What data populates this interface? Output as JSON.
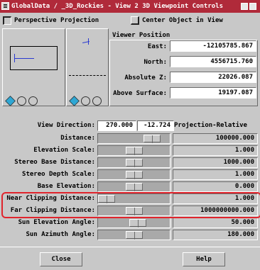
{
  "window": {
    "title": "GlobalData / _3D_Rockies - View 2 3D Viewpoint Controls"
  },
  "options": {
    "perspective_projection": "Perspective Projection",
    "perspective_checked": true,
    "center_object": "Center Object in View",
    "center_checked": false
  },
  "viewer_position": {
    "heading": "Viewer Position",
    "fields": [
      {
        "label": "East:",
        "value": "-12105785.867"
      },
      {
        "label": "North:",
        "value": "4556715.760"
      },
      {
        "label": "Absolute Z:",
        "value": "22026.087"
      },
      {
        "label": "Above Surface:",
        "value": "19197.087"
      }
    ]
  },
  "view_direction": {
    "label": "View Direction:",
    "azimuth": "270.000",
    "elevation": "-12.724",
    "mode": "Projection-Relative"
  },
  "sliders": [
    {
      "label": "Distance:",
      "value": "100000.000",
      "level": 0.83
    },
    {
      "label": "Elevation Scale:",
      "value": "1.000",
      "level": 0.5
    },
    {
      "label": "Stereo Base Distance:",
      "value": "1000.000",
      "level": 0.5
    },
    {
      "label": "Stereo Depth Scale:",
      "value": "1.000",
      "level": 0.5
    },
    {
      "label": "Base Elevation:",
      "value": "0.000",
      "level": 0.5
    },
    {
      "label": "Near Clipping Distance:",
      "value": "1.000",
      "level": 0.0
    },
    {
      "label": "Far Clipping Distance:",
      "value": "1000000000.000",
      "level": 0.5
    },
    {
      "label": "Sun Elevation Angle:",
      "value": "50.000",
      "level": 0.57
    },
    {
      "label": "Sun Azimuth Angle:",
      "value": "180.000",
      "level": 0.5
    }
  ],
  "buttons": {
    "close": "Close",
    "help": "Help"
  },
  "colors": {
    "titlebar": "#b02a3a",
    "highlight": "#e0242c"
  }
}
